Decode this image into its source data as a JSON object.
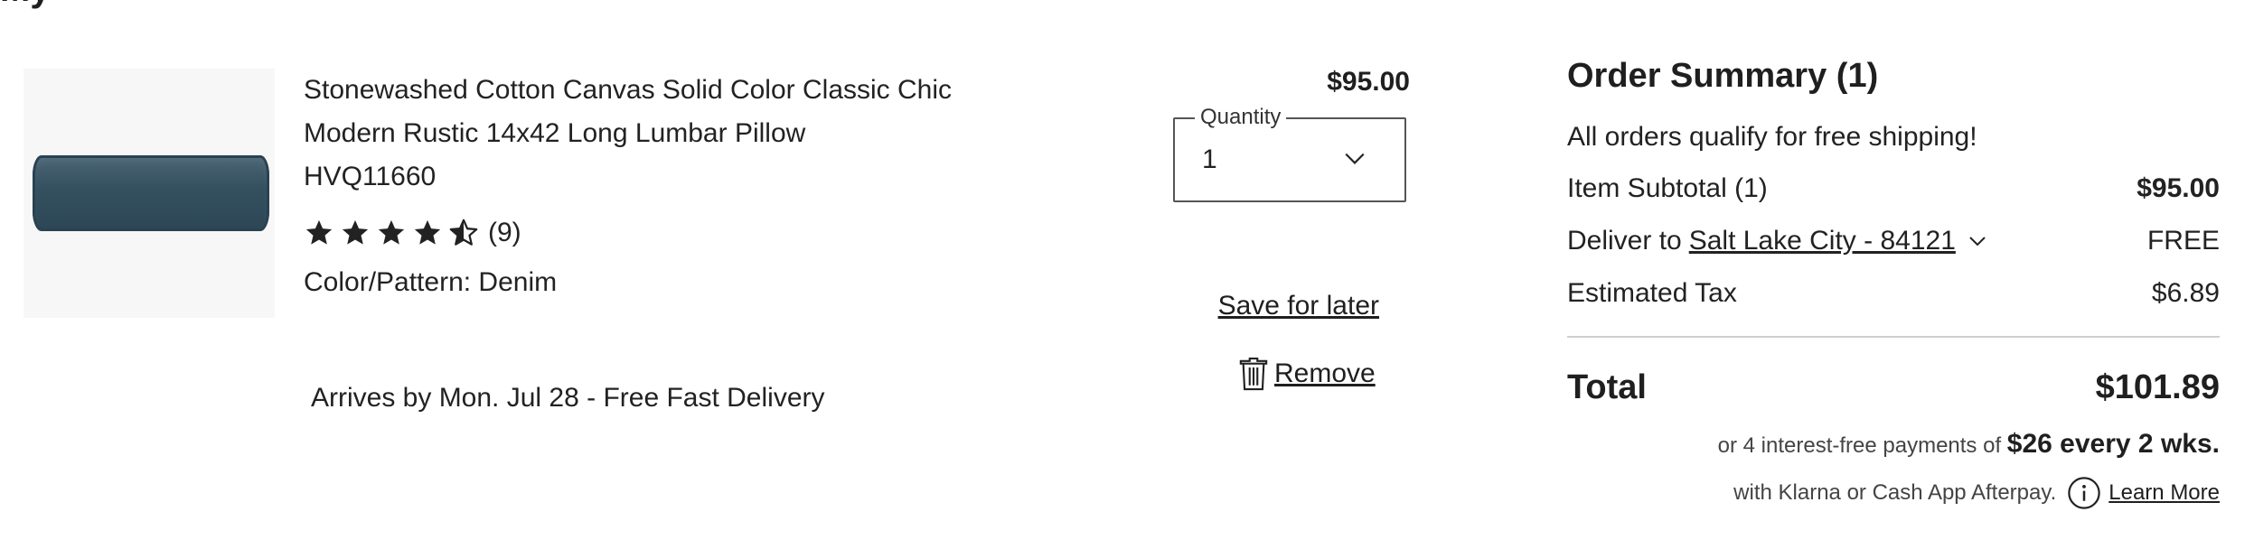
{
  "header": {
    "partial_heading": "My"
  },
  "cart_item": {
    "title": "Stonewashed Cotton Canvas Solid Color Classic Chic Modern Rustic 14x42 Long Lumbar Pillow",
    "sku": "HVQ11660",
    "rating": {
      "stars": 4.5,
      "count_label": "(9)"
    },
    "color_pattern": "Color/Pattern: Denim",
    "arrival": "Arrives by Mon. Jul 28 - Free Fast Delivery",
    "price": "$95.00",
    "quantity": {
      "label": "Quantity",
      "value": "1"
    },
    "save_for_later": "Save for later",
    "remove": "Remove",
    "image_icon": "lumbar-pillow-image"
  },
  "order_summary": {
    "title": "Order Summary (1)",
    "free_shipping_note": "All orders qualify for free shipping!",
    "item_subtotal_label": "Item Subtotal (1)",
    "item_subtotal_value": "$95.00",
    "deliver_to_label": "Deliver to",
    "deliver_to_location": "Salt Lake City - 84121",
    "deliver_value": "FREE",
    "tax_label": "Estimated Tax",
    "tax_value": "$6.89",
    "total_label": "Total",
    "total_value": "$101.89",
    "installments_prefix": "or 4 interest-free payments of",
    "installments_amount": "$26 every 2 wks.",
    "installments_provider": "with Klarna or Cash App Afterpay.",
    "learn_more": "Learn More"
  },
  "colors": {
    "text": "#1f1f1f",
    "star": "#222222",
    "pillow": "#3a5565",
    "divider": "#cfcfcf"
  }
}
